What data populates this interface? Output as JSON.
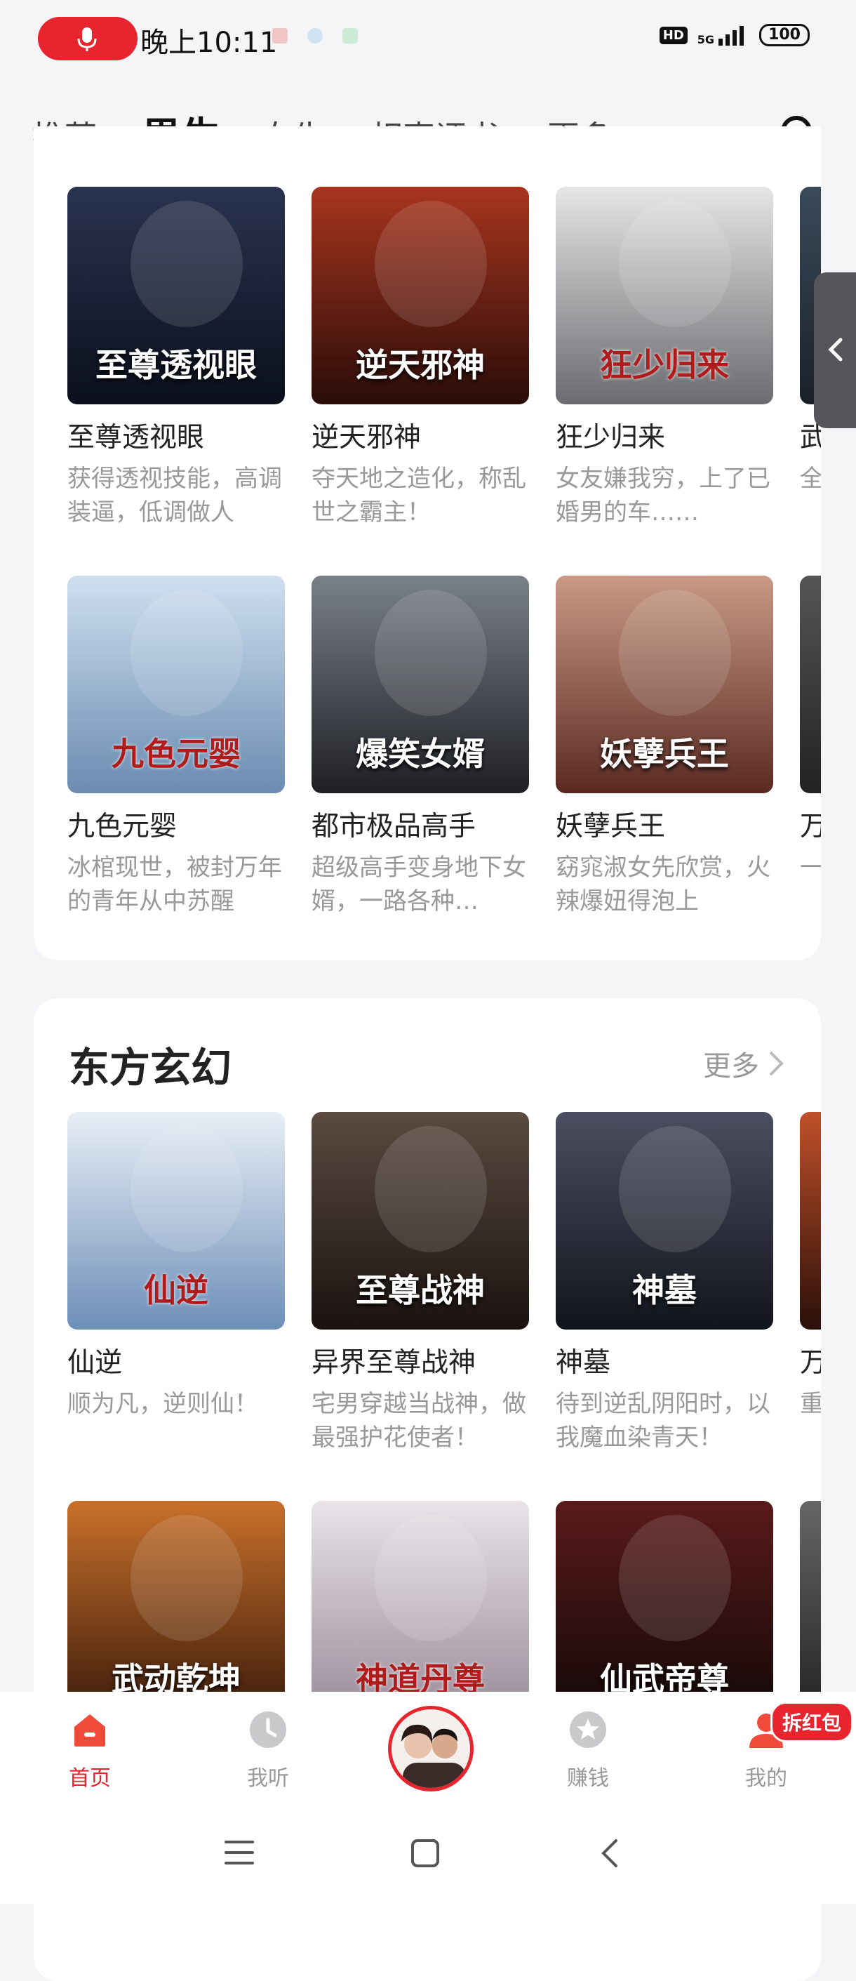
{
  "status_bar": {
    "time": "晚上10:11",
    "hd": "HD",
    "network": "5G",
    "battery": "100",
    "accent_color": "#e8242f"
  },
  "tabs": [
    {
      "label": "推荐"
    },
    {
      "label": "男生",
      "active": true
    },
    {
      "label": "女生"
    },
    {
      "label": "相声评书"
    },
    {
      "label": "更多"
    }
  ],
  "top_section": {
    "rows": [
      [
        {
          "title": "至尊透视眼",
          "desc": "获得透视技能，高调装逼，低调做人",
          "cover_text": "至尊透视眼",
          "cover_colors": [
            "#2a3350",
            "#0b0f1c"
          ]
        },
        {
          "title": "逆天邪神",
          "desc": "夺天地之造化，称乱世之霸主！",
          "cover_text": "逆天邪神",
          "cover_colors": [
            "#a8351e",
            "#2a0c08"
          ]
        },
        {
          "title": "狂少归来",
          "desc": "女友嫌我穷，上了已婚男的车……",
          "cover_text": "狂少归来",
          "cover_colors": [
            "#e6e6e6",
            "#6b6b70"
          ]
        },
        {
          "title": "武",
          "desc": "全幻",
          "cover_text": "",
          "cover_colors": [
            "#3a4a5a",
            "#1a2028"
          ]
        }
      ],
      [
        {
          "title": "九色元婴",
          "desc": "冰棺现世，被封万年的青年从中苏醒",
          "cover_text": "九色元婴",
          "cover_colors": [
            "#cfe0f0",
            "#6a8bb0"
          ]
        },
        {
          "title": "都市极品高手",
          "desc": "超级高手变身地下女婿，一路各种…",
          "cover_text": "爆笑女婿",
          "cover_colors": [
            "#7a8088",
            "#1e2024"
          ]
        },
        {
          "title": "妖孽兵王",
          "desc": "窈窕淑女先欣赏，火辣爆妞得泡上",
          "cover_text": "妖孽兵王",
          "cover_colors": [
            "#c89a84",
            "#5a2a22"
          ]
        },
        {
          "title": "万",
          "desc": "一九",
          "cover_text": "",
          "cover_colors": [
            "#555",
            "#222"
          ]
        }
      ]
    ]
  },
  "east_fantasy": {
    "title": "东方玄幻",
    "more_label": "更多",
    "rows": [
      [
        {
          "title": "仙逆",
          "desc": "顺为凡，逆则仙！",
          "cover_text": "仙逆",
          "cover_colors": [
            "#e8eef6",
            "#6d8fb8"
          ]
        },
        {
          "title": "异界至尊战神",
          "desc": "宅男穿越当战神，做最强护花使者！",
          "cover_text": "至尊战神",
          "cover_colors": [
            "#5a4a40",
            "#1a1210"
          ]
        },
        {
          "title": "神墓",
          "desc": "待到逆乱阴阳时，以我魔血染青天！",
          "cover_text": "神墓",
          "cover_colors": [
            "#4a4e60",
            "#12141c"
          ]
        },
        {
          "title": "万",
          "desc": "重击",
          "cover_text": "",
          "cover_colors": [
            "#c0502a",
            "#2a0f08"
          ]
        }
      ],
      [
        {
          "title": "",
          "desc": "",
          "cover_text": "武动乾坤",
          "cover_colors": [
            "#c8702a",
            "#3a1a0a"
          ]
        },
        {
          "title": "",
          "desc": "",
          "cover_text": "神道丹尊",
          "cover_colors": [
            "#e8e4e8",
            "#9a8a98"
          ]
        },
        {
          "title": "",
          "desc": "",
          "cover_text": "仙武帝尊",
          "cover_colors": [
            "#5a1a1a",
            "#120808"
          ]
        },
        {
          "title": "",
          "desc": "",
          "cover_text": "",
          "cover_colors": [
            "#666",
            "#222"
          ]
        }
      ]
    ]
  },
  "bottom_nav": [
    {
      "label": "首页",
      "icon": "home-icon",
      "active": true
    },
    {
      "label": "我听",
      "icon": "clock-icon"
    },
    {
      "label": "",
      "icon": "avatar"
    },
    {
      "label": "赚钱",
      "icon": "star-icon"
    },
    {
      "label": "我的",
      "icon": "user-icon"
    }
  ],
  "red_packet_badge": "拆红包"
}
